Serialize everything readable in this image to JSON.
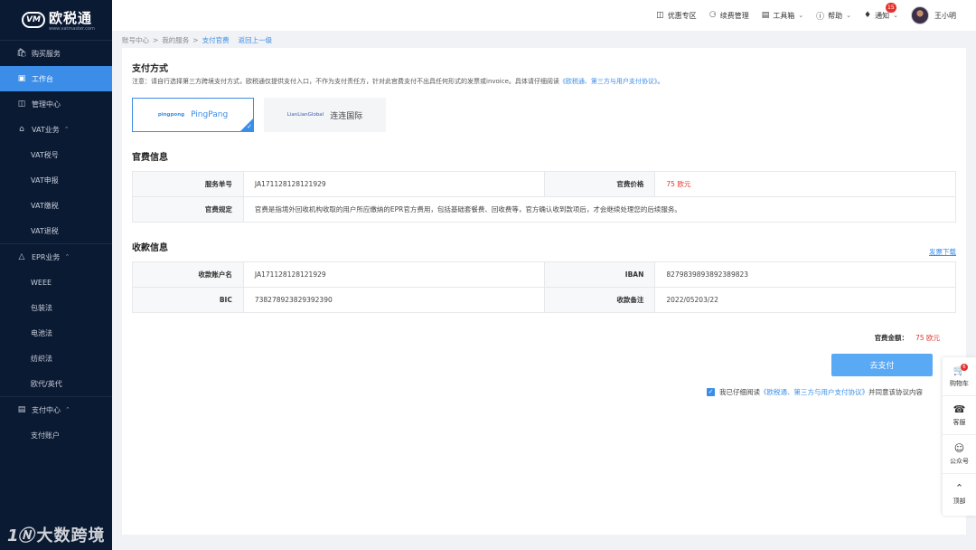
{
  "brand": {
    "mark": "VM",
    "name": "欧税通",
    "url": "www.vatmaster.com"
  },
  "sidebar": {
    "items": [
      {
        "label": "购买服务",
        "icon": "bag-icon"
      },
      {
        "label": "工作台",
        "icon": "desk-icon",
        "active": true
      },
      {
        "label": "管理中心",
        "icon": "monitor-icon"
      },
      {
        "label": "VAT业务",
        "icon": "bank-icon",
        "expanded": true
      },
      {
        "label": "VAT税号"
      },
      {
        "label": "VAT申报"
      },
      {
        "label": "VAT缴税"
      },
      {
        "label": "VAT退税"
      },
      {
        "label": "EPR业务",
        "icon": "person-icon",
        "expanded": true
      },
      {
        "label": "WEEE"
      },
      {
        "label": "包装法"
      },
      {
        "label": "电池法"
      },
      {
        "label": "纺织法"
      },
      {
        "label": "欧代/英代"
      },
      {
        "label": "支付中心",
        "icon": "wallet-icon",
        "expanded": true
      },
      {
        "label": "支付账户"
      }
    ]
  },
  "topbar": {
    "discount": "优惠专区",
    "renewal": "续费管理",
    "toolbox": "工具箱",
    "help": "帮助",
    "notify": "通知",
    "notify_count": "15",
    "username": "王小明"
  },
  "breadcrumb": {
    "items": [
      "账号中心",
      ">",
      "我的服务",
      ">"
    ],
    "current": "支付官费",
    "back": "返回上一级"
  },
  "payment": {
    "title": "支付方式",
    "note_prefix": "注意：请自行选择第三方跨境支付方式，欧税通仅提供支付入口，不作为支付责任方，针对此官费支付不出具任何形式的发票或invoice。具体请仔细阅读",
    "note_link": "《欧税通、第三方与用户支付协议》",
    "note_suffix": "。",
    "options": [
      {
        "logo": "pingpong",
        "label": "PingPang",
        "selected": true
      },
      {
        "logo": "LianLianGlobal",
        "label": "连连国际",
        "selected": false
      }
    ]
  },
  "fee": {
    "title": "官费信息",
    "order_label": "服务单号",
    "order_value": "JA171128128121929",
    "price_label": "官费价格",
    "price_value": "75 欧元",
    "rule_label": "官费规定",
    "rule_value": "官费是指境外回收机构收取的用户所应缴纳的EPR官方费用，包括基础套餐费、回收费等，官方确认收到款项后，才会继续处理您的后续服务。"
  },
  "receive": {
    "title": "收款信息",
    "download": "发票下载",
    "account_label": "收款账户名",
    "account_value": "JA171128128121929",
    "iban_label": "IBAN",
    "iban_value": "827983989389238​9823",
    "bic_label": "BIC",
    "bic_value": "738278923829392390",
    "remark_label": "收款备注",
    "remark_value": "2022/05203/22"
  },
  "checkout": {
    "total_label": "官费金额：",
    "total_value": "75 欧元",
    "pay_button": "去支付",
    "agree_prefix": "我已仔细阅读",
    "agree_link": "《欧税通、第三方与用户支付协议》",
    "agree_suffix": "并同意该协议内容"
  },
  "floatbar": {
    "cart": "购物车",
    "cart_count": "6",
    "service": "客服",
    "wechat": "公众号",
    "top": "顶部"
  },
  "colors": {
    "sidebar_bg": "#0b1a33",
    "accent": "#3b8de8",
    "danger": "#e5322d",
    "button": "#5aa9f5"
  }
}
